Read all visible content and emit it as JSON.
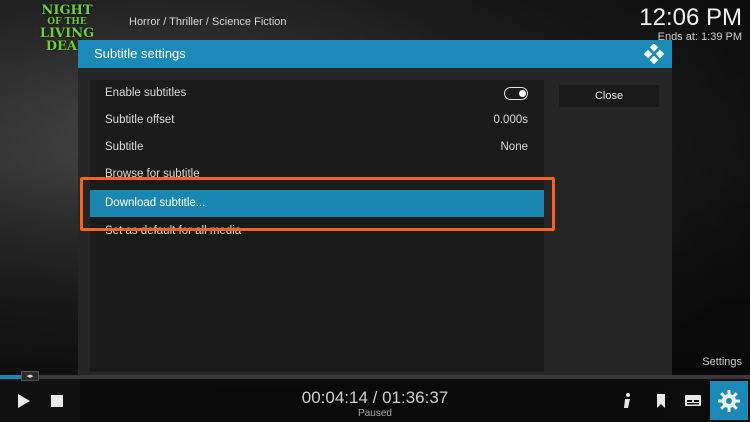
{
  "header": {
    "logo_line1": "NIGHT",
    "logo_line2": "OF THE",
    "logo_line3": "LIVING",
    "logo_line4": "DEAD",
    "breadcrumb": "Horror / Thriller / Science Fiction",
    "clock": "12:06 PM",
    "ends_at": "Ends at: 1:39 PM"
  },
  "dialog": {
    "title": "Subtitle settings",
    "close_label": "Close",
    "items": [
      {
        "label": "Enable subtitles",
        "value": "",
        "toggle": true
      },
      {
        "label": "Subtitle offset",
        "value": "0.000s"
      },
      {
        "label": "Subtitle",
        "value": "None"
      },
      {
        "label": "Browse for subtitle",
        "value": ""
      },
      {
        "label": "Download subtitle...",
        "value": "",
        "selected": true
      },
      {
        "label": "Set as default for all media",
        "value": ""
      }
    ]
  },
  "side": {
    "settings_label": "Settings"
  },
  "player": {
    "time": "00:04:14 / 01:36:37",
    "status": "Paused",
    "progress": 0.04
  },
  "colors": {
    "accent": "#1c8ab8",
    "highlight": "#f26422",
    "logo": "#6fcf3f"
  }
}
